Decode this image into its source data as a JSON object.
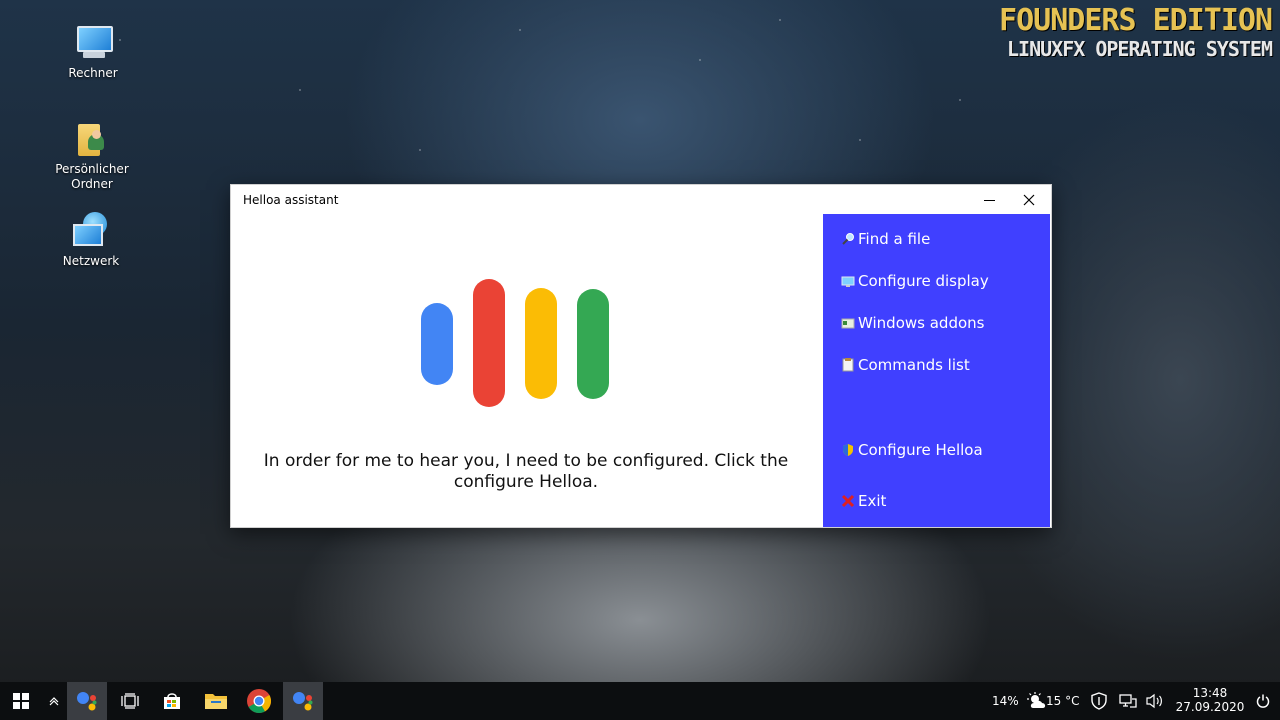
{
  "brand": {
    "line1": "FOUNDERS EDITION",
    "line2": "LINUXFX OPERATING SYSTEM"
  },
  "desktop_icons": [
    {
      "label": "Rechner",
      "icon": "computer-icon"
    },
    {
      "label": "Persönlicher Ordner",
      "icon": "user-folder-icon"
    },
    {
      "label": "Netzwerk",
      "icon": "network-icon"
    }
  ],
  "window": {
    "title": "Helloa assistant",
    "message": "In order for me to hear you, I need to be configured. Click the configure Helloa.",
    "logo_colors": [
      "#4285f4",
      "#ea4335",
      "#fbbc05",
      "#34a853"
    ],
    "sidebar_color": "#4040ff",
    "menu": [
      {
        "label": "Find a file",
        "icon": "magnifier-icon"
      },
      {
        "label": "Configure display",
        "icon": "monitor-icon"
      },
      {
        "label": "Windows addons",
        "icon": "addons-icon"
      },
      {
        "label": "Commands list",
        "icon": "clipboard-icon"
      },
      {
        "label": "Configure Helloa",
        "icon": "settings-shield-icon"
      },
      {
        "label": "Exit",
        "icon": "red-x-icon"
      }
    ]
  },
  "taskbar": {
    "battery": "14%",
    "temperature": "15 °C",
    "time": "13:48",
    "date": "27.09.2020"
  }
}
